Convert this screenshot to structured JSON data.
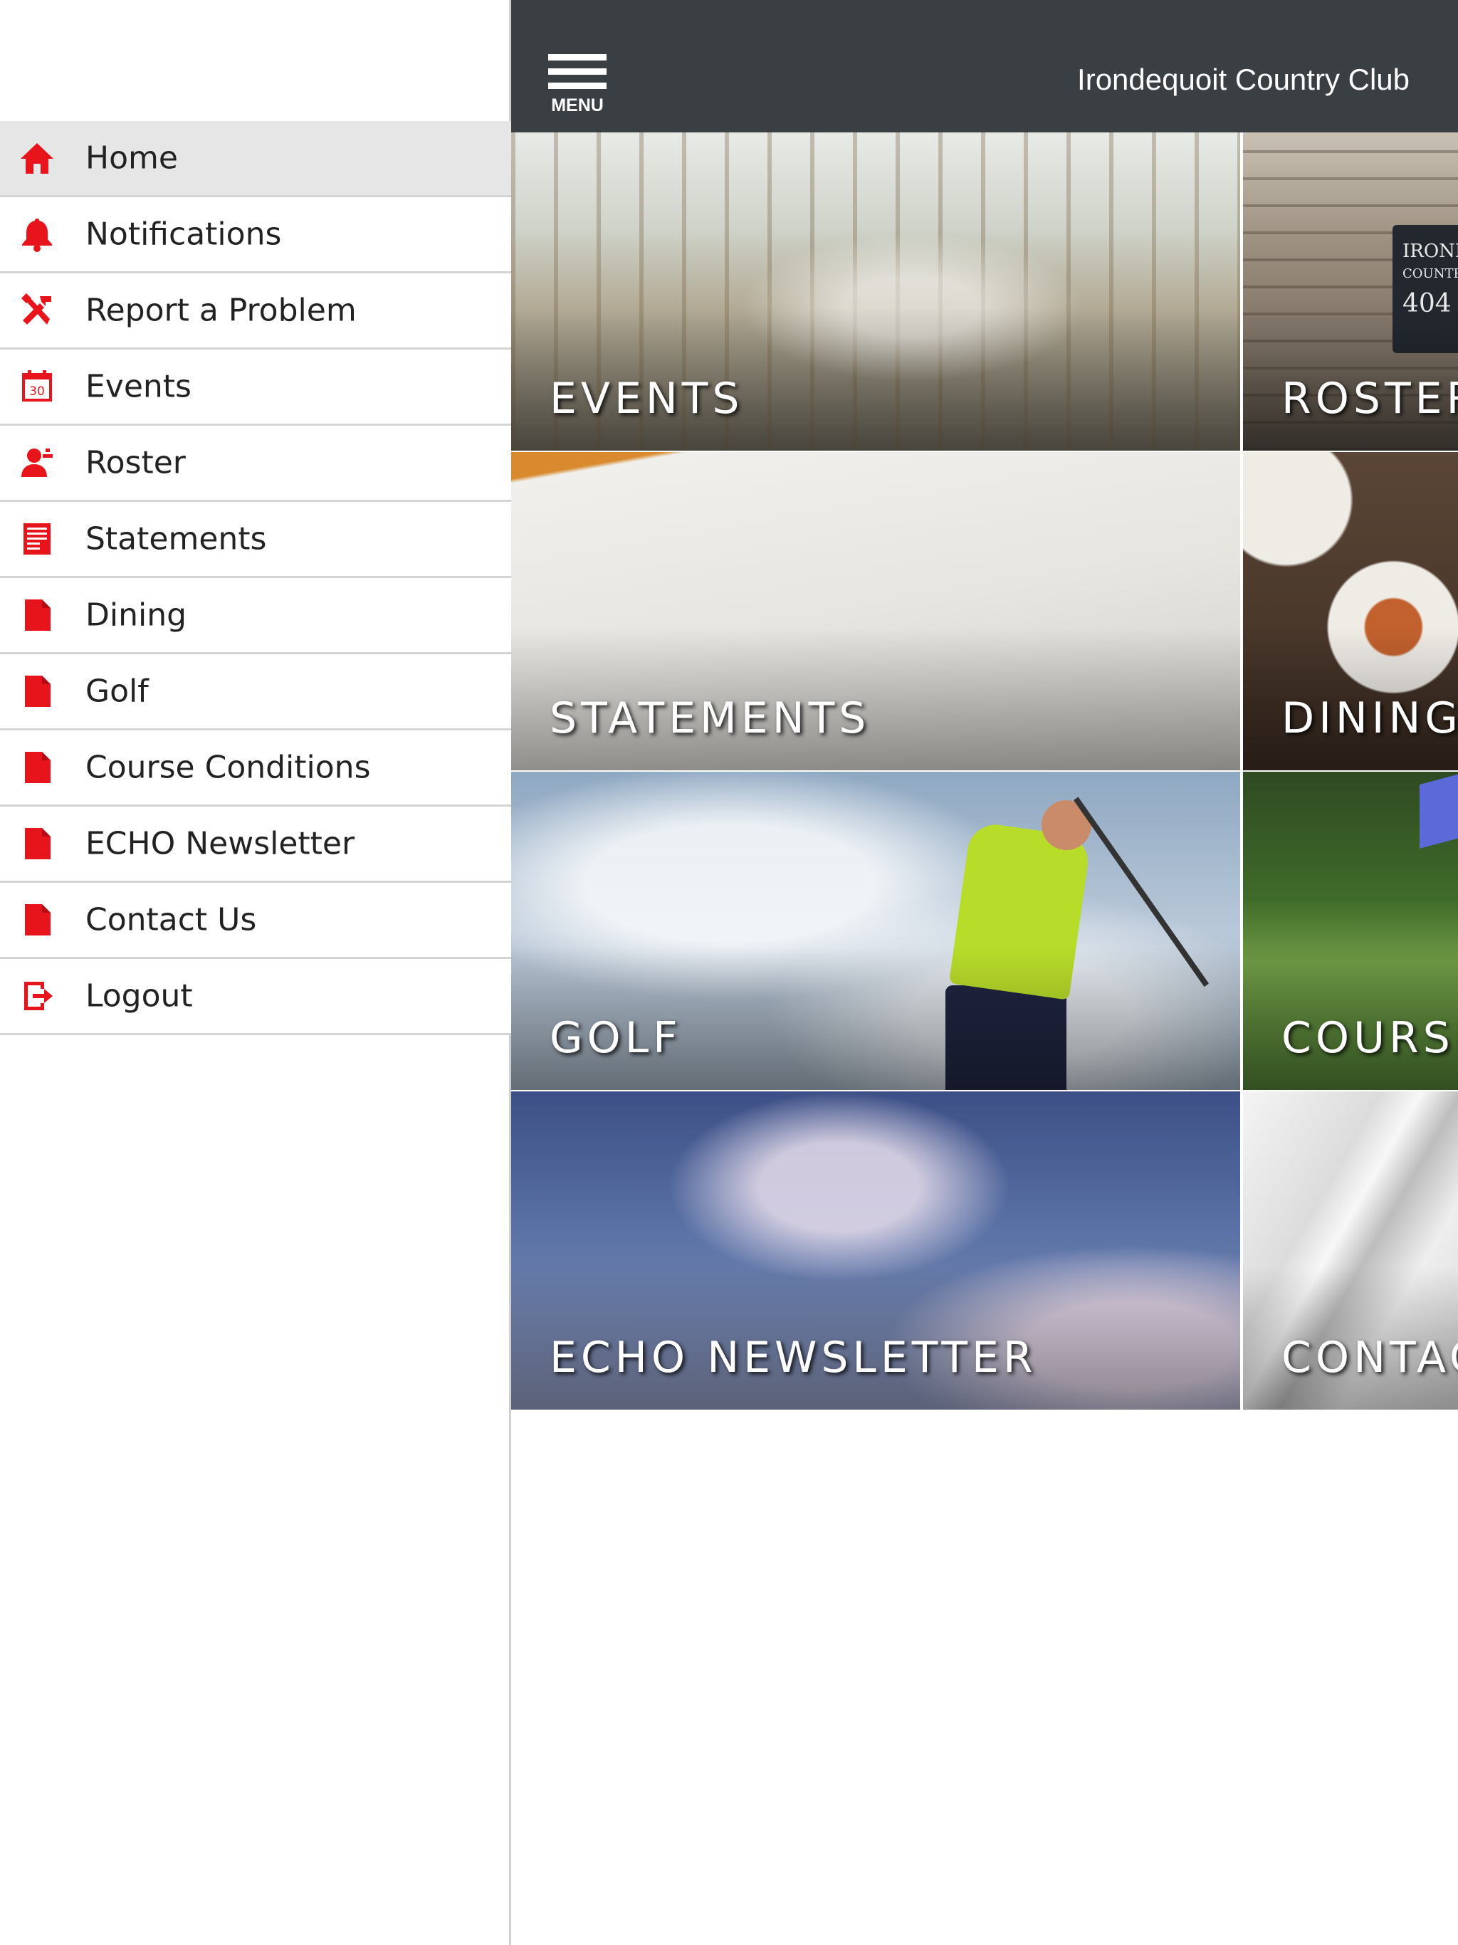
{
  "sidebar": {
    "items": [
      {
        "label": "Home",
        "icon": "home-icon",
        "active": true
      },
      {
        "label": "Notifications",
        "icon": "bell-icon"
      },
      {
        "label": "Report a Problem",
        "icon": "tools-icon"
      },
      {
        "label": "Events",
        "icon": "calendar-icon",
        "icon_text": "30"
      },
      {
        "label": "Roster",
        "icon": "person-icon"
      },
      {
        "label": "Statements",
        "icon": "statement-icon"
      },
      {
        "label": "Dining",
        "icon": "document-icon"
      },
      {
        "label": "Golf",
        "icon": "document-icon"
      },
      {
        "label": "Course Conditions",
        "icon": "document-icon"
      },
      {
        "label": "ECHO Newsletter",
        "icon": "document-icon"
      },
      {
        "label": "Contact Us",
        "icon": "document-icon"
      },
      {
        "label": "Logout",
        "icon": "logout-icon"
      }
    ]
  },
  "header": {
    "menu_label": "MENU",
    "club_name": "Irondequoit Country Club"
  },
  "tiles": [
    {
      "label": "EVENTS"
    },
    {
      "label": "ROSTER"
    },
    {
      "label": "STATEMENTS"
    },
    {
      "label": "DINING"
    },
    {
      "label": "GOLF"
    },
    {
      "label": "COURSE CONDITIONS"
    },
    {
      "label": "ECHO NEWSLETTER"
    },
    {
      "label": "CONTACT US"
    }
  ],
  "decor": {
    "sign_line1": "IRONDE",
    "sign_line2": "COUNTRY",
    "sign_line3": "404"
  },
  "colors": {
    "accent": "#e8141c",
    "topbar": "#3a3f44",
    "active_item": "#e6e6e6"
  }
}
